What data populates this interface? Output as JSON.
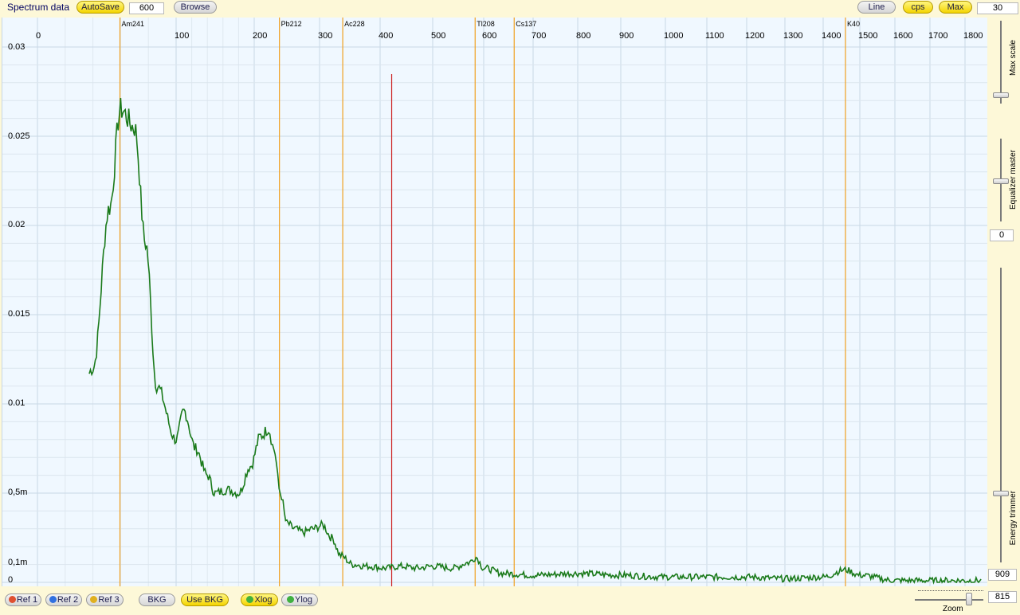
{
  "window": {
    "title": "Spectrum data"
  },
  "toolbar": {
    "autosave_label": "AutoSave",
    "interval_value": "600",
    "browse_label": "Browse",
    "line_label": "Line",
    "cps_label": "cps",
    "max_label": "Max",
    "max_value": "30"
  },
  "right_panel": {
    "max_scale_label": "Max scale",
    "equalizer_label": "Equalizer master",
    "equalizer_value": "0",
    "energy_trimmer_label": "Energy trimmer",
    "energy_trimmer_value": "909",
    "zoom_label": "Zoom",
    "zoom_value": "815"
  },
  "bottom": {
    "ref1_label": "Ref 1",
    "ref2_label": "Ref 2",
    "ref3_label": "Ref 3",
    "bkg_label": "BKG",
    "use_bkg_label": "Use BKG",
    "xlog_label": "Xlog",
    "ylog_label": "Ylog"
  },
  "colors": {
    "spectrum": "#1a7a1a",
    "isotope_line": "#f0a020",
    "cursor_line": "#cc2020",
    "ref1_dot": "#e05030",
    "ref2_dot": "#3070e0",
    "ref3_dot": "#e0b020",
    "log_dot": "#40b040"
  },
  "chart_data": {
    "type": "line",
    "x_tick_labels": [
      "0",
      "100",
      "200",
      "300",
      "400",
      "500",
      "600",
      "700",
      "800",
      "900",
      "1000",
      "1100",
      "1200",
      "1300",
      "1400",
      "1500",
      "1600",
      "1700",
      "1800"
    ],
    "y_tick_labels": [
      "0.03",
      "0.025",
      "0.02",
      "0.015",
      "0.01",
      "0,5m",
      "0,1m",
      "0"
    ],
    "isotopes": [
      {
        "name": "Am241",
        "energy": 59.5
      },
      {
        "name": "Pb212",
        "energy": 238.6
      },
      {
        "name": "Ac228",
        "energy": 338.3
      },
      {
        "name": "Tl208",
        "energy": 583.2
      },
      {
        "name": "Cs137",
        "energy": 661.7
      },
      {
        "name": "K40",
        "energy": 1460.8
      }
    ],
    "cursor_energy": 422,
    "series": [
      {
        "energy": [
          -20,
          -5,
          10,
          25,
          40,
          52,
          60,
          70,
          78,
          86,
          100,
          110,
          125,
          140,
          150,
          165,
          180,
          195,
          210,
          222,
          230,
          240,
          250,
          262,
          275,
          290,
          305,
          320,
          335,
          355,
          380,
          410,
          440,
          470,
          500,
          540,
          570,
          585,
          600,
          640,
          700,
          800,
          900,
          1000,
          1100,
          1200,
          1300,
          1400,
          1460,
          1500,
          1600,
          1700,
          1800,
          1850
        ],
        "counts": [
          0.0036,
          0.0048,
          0.0062,
          0.008,
          0.012,
          0.021,
          0.0265,
          0.0255,
          0.019,
          0.011,
          0.008,
          0.0096,
          0.0075,
          0.006,
          0.005,
          0.0052,
          0.005,
          0.0065,
          0.0082,
          0.0086,
          0.0075,
          0.005,
          0.0033,
          0.003,
          0.0028,
          0.003,
          0.0032,
          0.0025,
          0.0015,
          0.001,
          0.0009,
          0.0008,
          0.0009,
          0.0008,
          0.0009,
          0.0008,
          0.0011,
          0.0014,
          0.0008,
          0.0005,
          0.0004,
          0.0005,
          0.0004,
          0.0003,
          0.0003,
          0.0003,
          0.0002,
          0.0003,
          0.0007,
          0.0004,
          0.0001,
          0.0001,
          0.0001,
          0.0001
        ]
      }
    ],
    "xlim": [
      -40,
      1860
    ],
    "ylim": [
      0,
      0.03
    ],
    "xlog": true,
    "grid": true
  }
}
